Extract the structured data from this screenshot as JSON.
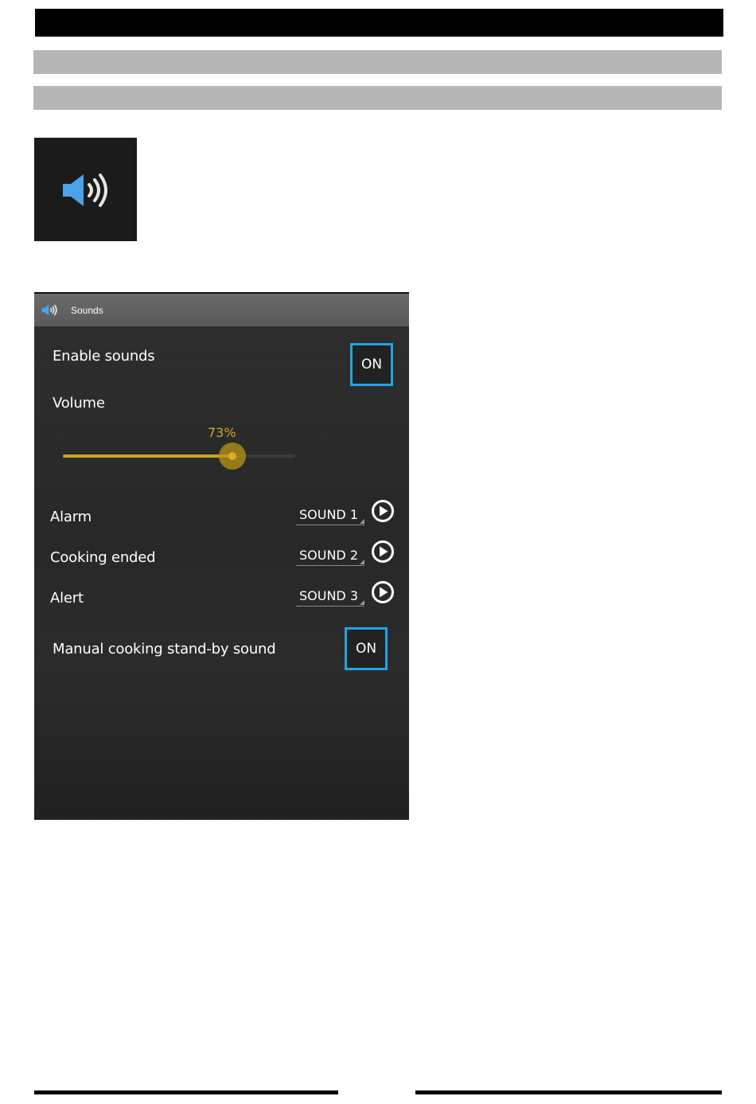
{
  "screen": {
    "header_title": "Sounds",
    "header_icon": "speaker-icon",
    "enable_sounds": {
      "label": "Enable sounds",
      "value": "ON"
    },
    "volume": {
      "label": "Volume",
      "value_text": "73%",
      "fraction": 0.73
    },
    "sound_rows": [
      {
        "label": "Alarm",
        "value": "SOUND 1",
        "icon": "play-icon"
      },
      {
        "label": "Cooking ended",
        "value": "SOUND 2",
        "icon": "play-icon"
      },
      {
        "label": "Alert",
        "value": "SOUND 3",
        "icon": "play-icon"
      }
    ],
    "standby_sound": {
      "label": "Manual cooking stand-by sound",
      "value": "ON"
    }
  },
  "colors": {
    "accent_blue": "#1ea6e6",
    "slider_gold": "#c9a51f",
    "speaker_blue": "#4aa3e8"
  }
}
